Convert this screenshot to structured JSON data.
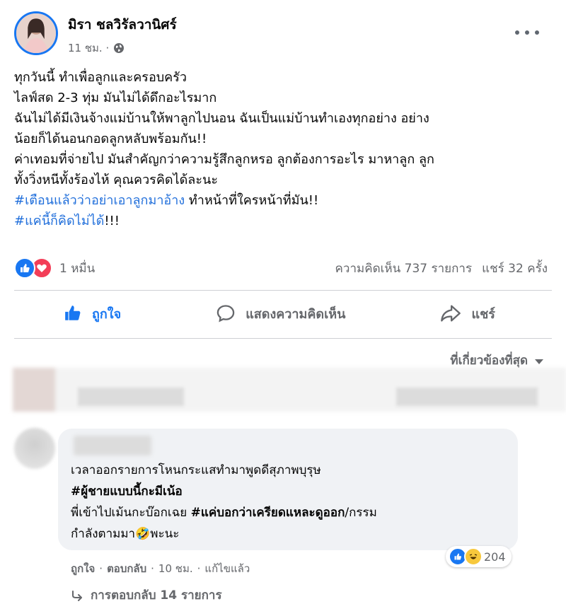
{
  "post": {
    "author": "มิรา ชลวิรัลวานิศร์",
    "time": "11 ชม. ·",
    "lines": {
      "l1": "ทุกวันนี้ ทำเพื่อลูกและครอบครัว",
      "l2": "ไลฟ์สด 2-3 ทุ่ม มันไม่ได้ดึกอะไรมาก",
      "l3": "ฉันไม่ได้มีเงินจ้างแม่บ้านให้พาลูกไปนอน ฉันเป็นแม่บ้านทำเองทุกอย่าง อย่าง",
      "l4": "น้อยก็ได้นอนกอดลูกหลับพร้อมกัน!!",
      "l5": "ค่าเทอมที่จ่ายไป มันสำคัญกว่าความรู้สึกลูกหรอ ลูกต้องการอะไร มาหาลูก ลูก",
      "l6": "ทั้งวิ่งหนีทั้งร้องไห้ คุณควรคิดได้ละนะ",
      "l7_tag": "#เตือนแล้วว่าอย่าเอาลูกมาอ้าง",
      "l7_rest": " ทำหน้าที่ใครหน้าที่มัน!!",
      "l8_tag": "#แค่นี้ก็คิดไม่ได้",
      "l8_rest": "!!!"
    },
    "reactions_count": "1 หมื่น",
    "comments_count": "ความคิดเห็น 737 รายการ",
    "shares_count": "แชร์ 32 ครั้ง"
  },
  "actions": {
    "like": "ถูกใจ",
    "comment": "แสดงความคิดเห็น",
    "share": "แชร์"
  },
  "sort_label": "ที่เกี่ยวข้องที่สุด",
  "comment": {
    "line1": "เวลาออกรายการโหนกระแสทำมาพูดดีสุภาพบุรุษ",
    "line2": "#ผู้ชายแบบนี้กะมีเน้อ",
    "line3_a": "พี่เข้าไปเม้นกะบ๊อกเฉย ",
    "line3_tag": "#แค่บอกว่าเครียดแหละดูออก",
    "line3_b": "/กรรม",
    "line4_a": "กำลังตามมา",
    "line4_emoji": "🤣",
    "line4_b": "พะนะ",
    "reaction_count": "204",
    "like": "ถูกใจ",
    "sep1": "·",
    "reply": "ตอบกลับ",
    "sep2": "·",
    "time": "10 ชม.",
    "sep3": "·",
    "edited": "แก้ไขแล้ว",
    "replies_label": "การตอบกลับ 14 รายการ"
  },
  "colors": {
    "brand": "#1877f2",
    "love": "#f33e58",
    "hashtag": "#216fdb",
    "secondary_text": "#65676b"
  }
}
